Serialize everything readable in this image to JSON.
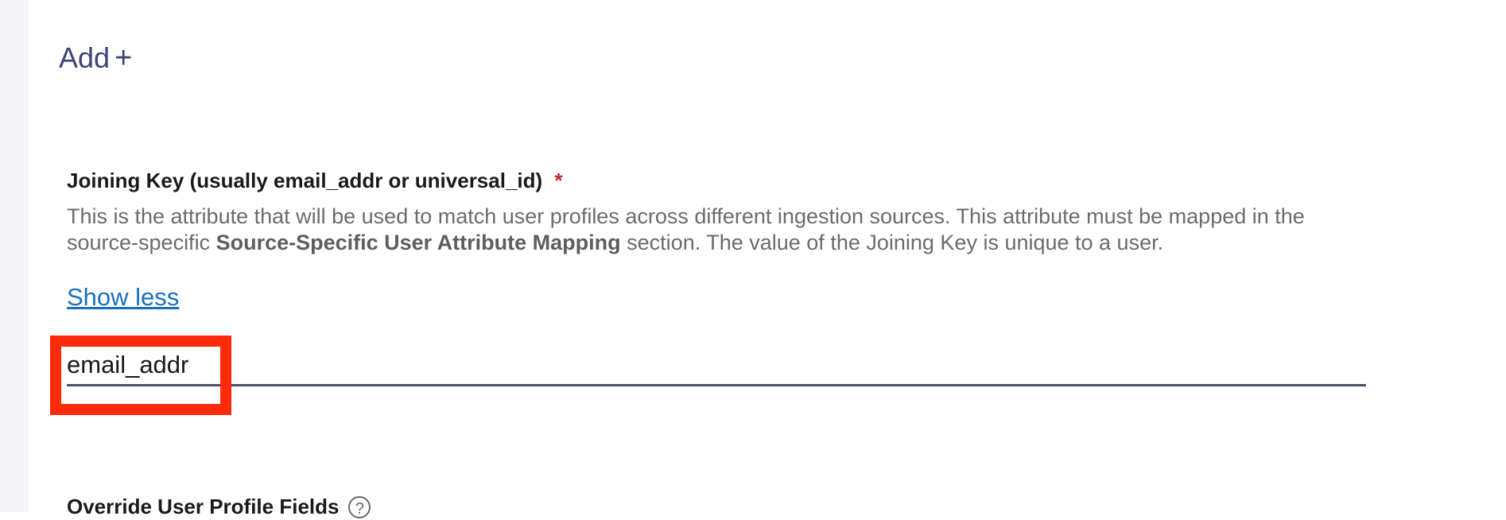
{
  "add": {
    "label": "Add",
    "icon": "+"
  },
  "joining_key": {
    "label": "Joining Key (usually email_addr or universal_id)",
    "required_mark": "*",
    "help_part1": "This is the attribute that will be used to match user profiles across different ingestion sources. This attribute must be mapped in the source-specific ",
    "help_bold": "Source-Specific User Attribute Mapping",
    "help_part2": " section. The value of the Joining Key is unique to a user.",
    "show_less": "Show less",
    "value": "email_addr",
    "placeholder": ""
  },
  "override": {
    "label": "Override User Profile Fields",
    "help_icon": "?"
  },
  "colors": {
    "accent": "#3b4477",
    "link": "#1a70b8",
    "required": "#c0242b",
    "highlight": "#ff2a0a"
  }
}
